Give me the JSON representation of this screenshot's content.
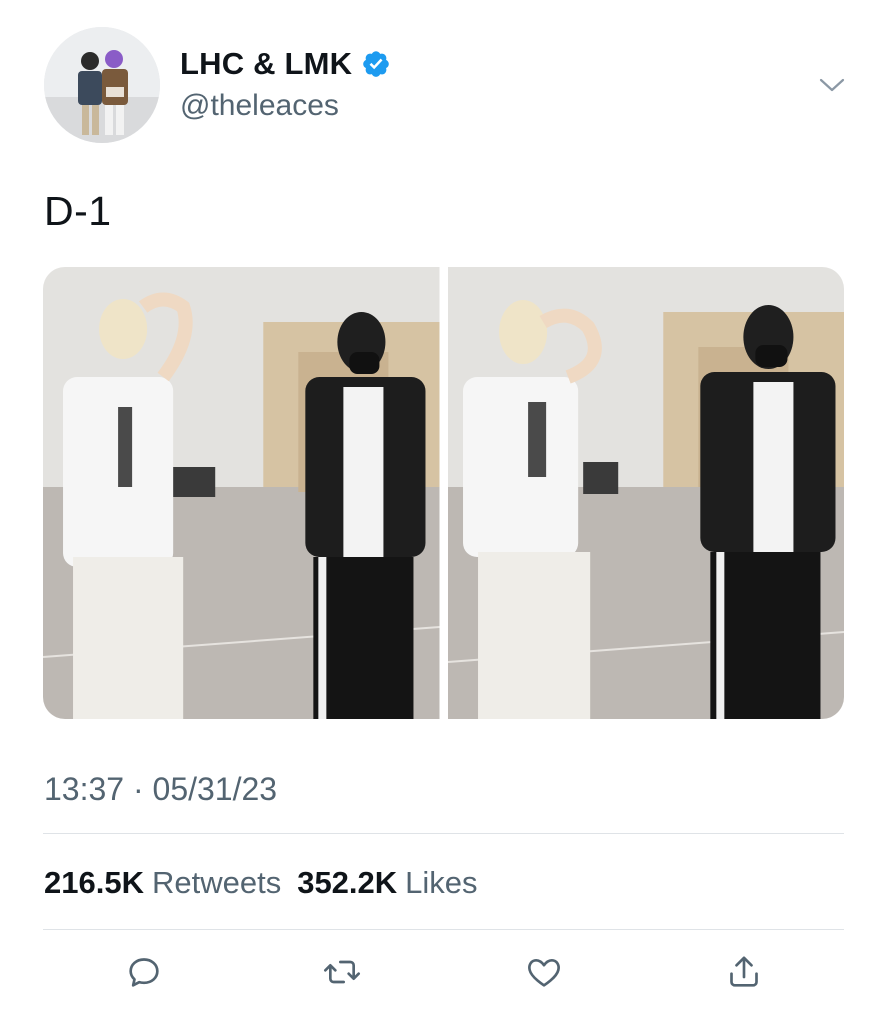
{
  "tweet": {
    "display_name": "LHC & LMK",
    "handle": "@theleaces",
    "text": "D-1",
    "timestamp": "13:37 · 05/31/23"
  },
  "stats": {
    "retweets_count": "216.5K",
    "retweets_label": "Retweets",
    "likes_count": "352.2K",
    "likes_label": "Likes"
  },
  "icons": {
    "verified": "verified-badge-icon",
    "menu": "chevron-down-icon",
    "reply": "reply-icon",
    "retweet": "retweet-icon",
    "like": "heart-icon",
    "share": "share-icon"
  },
  "colors": {
    "verified_blue": "#1d9bf0",
    "secondary_text": "#536471",
    "primary_text": "#0f1419"
  }
}
